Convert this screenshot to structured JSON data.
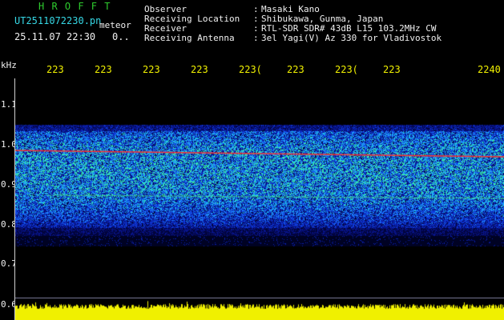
{
  "header": {
    "brand": "H R O F F T",
    "filename": "UT2511072230.pn",
    "tag": "meteor",
    "datetime": "25.11.07 22:30",
    "count": "0..",
    "info": [
      {
        "label": "Observer",
        "sep": ":",
        "value": "Masaki Kano"
      },
      {
        "label": "Receiving Location",
        "sep": ":",
        "value": "Shibukawa, Gunma, Japan"
      },
      {
        "label": "Receiver",
        "sep": ":",
        "value": "RTL-SDR SDR# 43dB L15 103.2MHz CW"
      },
      {
        "label": "Receiving Antenna",
        "sep": ":",
        "value": "3el Yagi(V) Az 330 for Vladivostok"
      }
    ]
  },
  "axes": {
    "y_unit": "kHz",
    "y_ticks": [
      "1.1",
      "1.0",
      "0.9",
      "0.8",
      "0.7",
      "0.6"
    ],
    "x_ticks": [
      "223",
      "223",
      "223",
      "223",
      "223(",
      "223",
      "223(",
      "223",
      "2240"
    ]
  },
  "colors": {
    "background": "#000000",
    "noise_low": "#0a14c8",
    "noise_mid": "#1e8cff",
    "noise_high": "#40f0a0",
    "carrier": "#ff3030",
    "bottom_bar": "#f0f000"
  }
}
